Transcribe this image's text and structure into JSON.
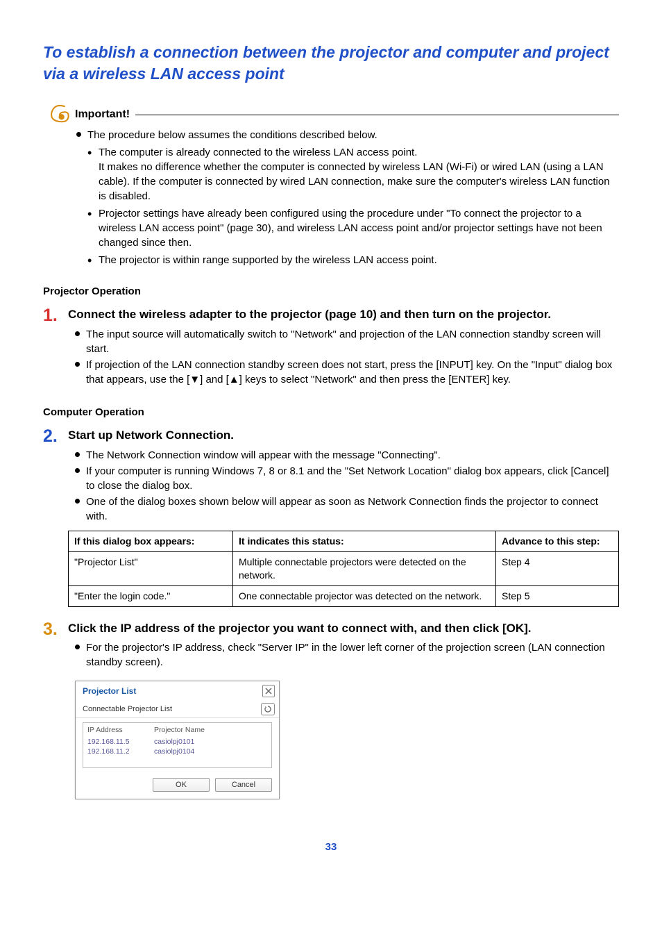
{
  "title": "To establish a connection between the projector and computer and project via a wireless LAN access point",
  "important_label": "Important!",
  "important": {
    "intro": "The procedure below assumes the conditions described below.",
    "sub1": "The computer is already connected to the wireless LAN access point.\nIt makes no difference whether the computer is connected by wireless LAN (Wi-Fi) or wired LAN (using a LAN cable). If the computer is connected by wired LAN connection, make sure the computer's wireless LAN function is disabled.",
    "sub2": "Projector settings have already been configured using the procedure under \"To connect the projector to a wireless LAN access point\" (page 30), and wireless LAN access point and/or projector settings have not been changed since then.",
    "sub3": "The projector is within range supported by the wireless LAN access point."
  },
  "projector_op": "Projector Operation",
  "step1": {
    "title": "Connect the wireless adapter to the projector (page 10) and then turn on the projector.",
    "b1": "The input source will automatically switch to \"Network\" and projection of the LAN connection standby screen will start.",
    "b2": "If projection of the LAN connection standby screen does not start, press the [INPUT] key. On the \"Input\" dialog box that appears, use the [▼] and [▲] keys to select \"Network\" and then press the [ENTER] key."
  },
  "computer_op": "Computer Operation",
  "step2": {
    "title": "Start up Network Connection.",
    "b1": "The Network Connection window will appear with the message \"Connecting\".",
    "b2": "If your computer is running Windows 7, 8 or 8.1 and the \"Set Network Location\" dialog box appears, click [Cancel] to close the dialog box.",
    "b3": "One of the dialog boxes shown below will appear as soon as Network Connection finds the projector to connect with."
  },
  "table": {
    "h1": "If this dialog box appears:",
    "h2": "It indicates this status:",
    "h3": "Advance to this step:",
    "r1c1": "\"Projector List\"",
    "r1c2": "Multiple connectable projectors were detected on the network.",
    "r1c3": "Step 4",
    "r2c1": "\"Enter the login code.\"",
    "r2c2": "One connectable projector was detected on the network.",
    "r2c3": "Step 5"
  },
  "step3": {
    "title": "Click the IP address of the projector you want to connect with, and then click [OK].",
    "b1": "For the projector's IP address, check \"Server IP\" in the lower left corner of the projection screen (LAN connection standby screen)."
  },
  "dialog": {
    "title": "Projector List",
    "subtitle": "Connectable Projector List",
    "col_ip": "IP Address",
    "col_name": "Projector Name",
    "rows": [
      {
        "ip": "192.168.11.5",
        "name": "casiolpj0101"
      },
      {
        "ip": "192.168.11.2",
        "name": "casiolpj0104"
      }
    ],
    "ok": "OK",
    "cancel": "Cancel"
  },
  "page_num": "33"
}
